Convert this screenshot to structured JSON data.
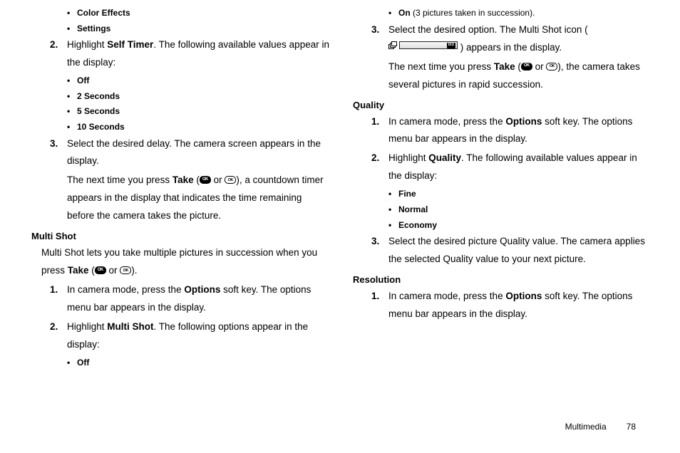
{
  "left": {
    "bullets_top": [
      "Color Effects",
      "Settings"
    ],
    "step2_pre": "Highlight ",
    "step2_bold": "Self Timer",
    "step2_post": ". The following available values appear in the display:",
    "timer_values": [
      "Off",
      "2 Seconds",
      "5 Seconds",
      "10 Seconds"
    ],
    "step3": "Select the desired delay. The camera screen appears in the display.",
    "step3b_pre": "The next time you press ",
    "step3b_bold": "Take",
    "step3b_post": " ( ",
    "step3b_or": " or ",
    "step3b_close": " ), a countdown timer appears in the display that indicates the time remaining before the camera takes the picture.",
    "multishot_heading": "Multi Shot",
    "multishot_intro_pre": "Multi Shot lets you take multiple pictures in succession when you press ",
    "multishot_intro_bold": "Take",
    "multishot_intro_or": " or ",
    "ms_step1_pre": "In camera mode, press the ",
    "ms_step1_bold": "Options",
    "ms_step1_post": " soft key. The options menu bar appears in the display.",
    "ms_step2_pre": "Highlight ",
    "ms_step2_bold": "Multi Shot",
    "ms_step2_post": ". The following options appear in the display:",
    "ms_off": "Off"
  },
  "right": {
    "on_bold": "On",
    "on_post": " (3 pictures taken in succession).",
    "step3_pre": "Select the desired option. The Multi Shot icon (",
    "step3_post": ") appears in the display.",
    "ms_badge": "0/3",
    "step3b_pre": "The next time you press ",
    "step3b_bold": "Take",
    "step3b_or": " or ",
    "step3b_close": "), the camera takes several pictures in rapid succession.",
    "quality_heading": "Quality",
    "q_step1_pre": "In camera mode, press the ",
    "q_step1_bold": "Options",
    "q_step1_post": " soft key. The options menu bar appears in the display.",
    "q_step2_pre": "Highlight ",
    "q_step2_bold": "Quality",
    "q_step2_post": ". The following available values appear in the display:",
    "quality_values": [
      "Fine",
      "Normal",
      "Economy"
    ],
    "q_step3": "Select the desired picture Quality value. The camera applies the selected Quality value to your next picture.",
    "resolution_heading": "Resolution",
    "r_step1_pre": "In camera mode, press the ",
    "r_step1_bold": "Options",
    "r_step1_post": " soft key. The options menu bar appears in the display."
  },
  "footer": {
    "section": "Multimedia",
    "page": "78"
  },
  "labels": {
    "n2": "2.",
    "n3": "3.",
    "n1": "1.",
    "ok": "OK"
  }
}
